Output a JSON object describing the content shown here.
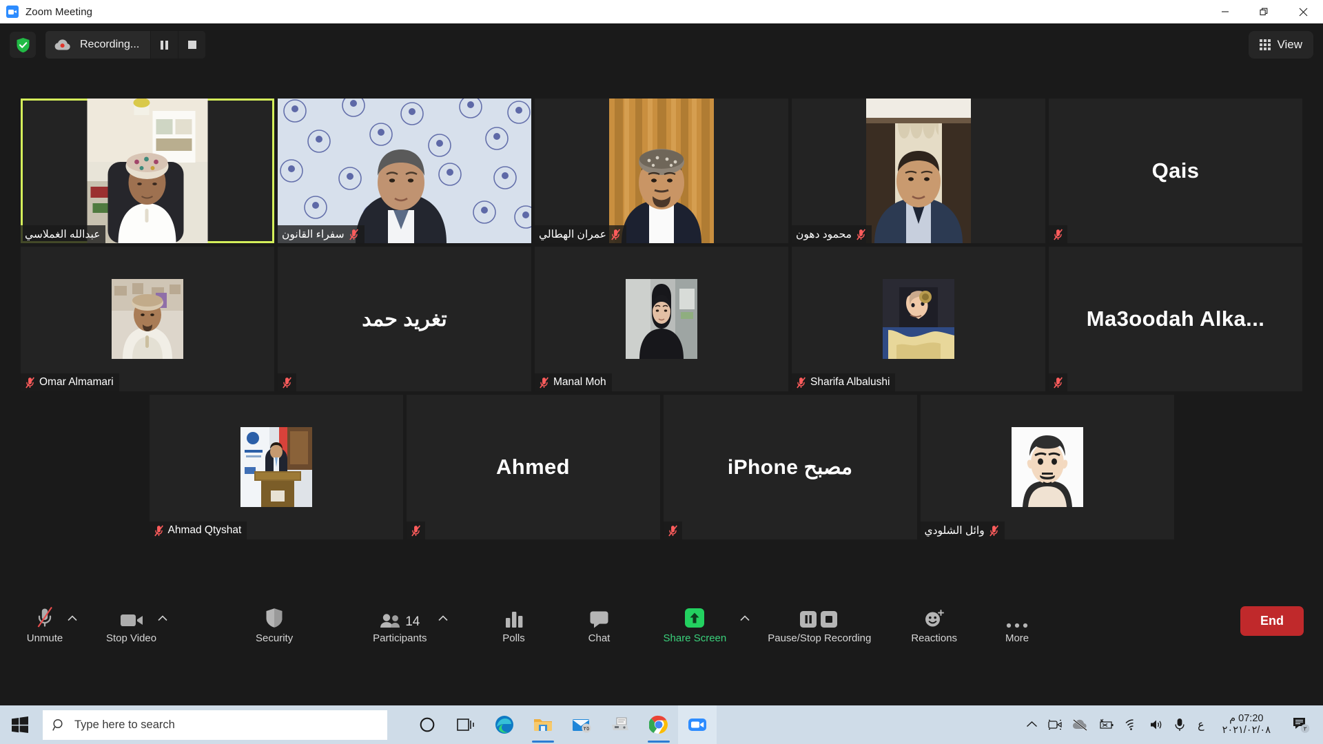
{
  "window": {
    "title": "Zoom Meeting",
    "app_icon": "zoom-icon",
    "minimize_label": "Minimize",
    "restore_label": "Restore",
    "close_label": "Close"
  },
  "header": {
    "security_shield": "shield-check-icon",
    "recording_label": "Recording...",
    "recording_icon": "recording-cloud-icon",
    "pause_recording_label": "Pause Recording",
    "stop_recording_label": "Stop Recording",
    "view_label": "View",
    "view_icon": "grid-view-icon"
  },
  "grid": {
    "rows": [
      [
        {
          "name": "عبدالله الغملاسي",
          "display": "name-strip",
          "video": true,
          "muted": false,
          "active_speaker": true,
          "rtl": true
        },
        {
          "name": "سفراء القانون",
          "display": "name-strip",
          "video": true,
          "muted": true,
          "active_speaker": false,
          "rtl": true
        },
        {
          "name": "عمران الهطالي",
          "display": "name-strip",
          "video": true,
          "muted": true,
          "active_speaker": false,
          "rtl": true
        },
        {
          "name": "محمود دهون",
          "display": "name-strip",
          "video": true,
          "muted": true,
          "active_speaker": false,
          "rtl": true
        },
        {
          "name": "Qais",
          "display": "big-name",
          "video": false,
          "muted": true,
          "active_speaker": false,
          "rtl": false
        }
      ],
      [
        {
          "name": "Omar Almamari",
          "display": "avatar",
          "video": false,
          "muted": true,
          "active_speaker": false,
          "rtl": false
        },
        {
          "name": "تغريد حمد",
          "display": "big-name",
          "video": false,
          "muted": true,
          "active_speaker": false,
          "rtl": true
        },
        {
          "name": "Manal Moh",
          "display": "avatar",
          "video": false,
          "muted": true,
          "active_speaker": false,
          "rtl": false
        },
        {
          "name": "Sharifa Albalushi",
          "display": "avatar",
          "video": false,
          "muted": true,
          "active_speaker": false,
          "rtl": false
        },
        {
          "name": "Ma3oodah Alka...",
          "display": "big-name",
          "video": false,
          "muted": true,
          "active_speaker": false,
          "rtl": false
        }
      ],
      [
        {
          "name": "Ahmad Qtyshat",
          "display": "avatar",
          "video": false,
          "muted": true,
          "active_speaker": false,
          "rtl": false
        },
        {
          "name": "Ahmed",
          "display": "big-name",
          "video": false,
          "muted": true,
          "active_speaker": false,
          "rtl": false
        },
        {
          "name": "مصبح iPhone",
          "display": "big-name",
          "video": false,
          "muted": true,
          "active_speaker": false,
          "rtl": true
        },
        {
          "name": "وائل الشلودي",
          "display": "avatar",
          "video": false,
          "muted": true,
          "active_speaker": false,
          "rtl": true
        }
      ]
    ]
  },
  "controls": {
    "unmute": {
      "label": "Unmute",
      "icon": "mic-muted-icon",
      "has_caret": true
    },
    "stop_video": {
      "label": "Stop Video",
      "icon": "video-camera-icon",
      "has_caret": true
    },
    "security": {
      "label": "Security",
      "icon": "shield-icon",
      "has_caret": false
    },
    "participants": {
      "label": "Participants",
      "icon": "people-icon",
      "count": "14",
      "has_caret": true
    },
    "polls": {
      "label": "Polls",
      "icon": "bar-chart-icon",
      "has_caret": false
    },
    "chat": {
      "label": "Chat",
      "icon": "speech-bubble-icon",
      "has_caret": false
    },
    "share_screen": {
      "label": "Share Screen",
      "icon": "share-arrow-up-icon",
      "has_caret": true
    },
    "recording": {
      "label": "Pause/Stop Recording",
      "icon": "pause-stop-icon",
      "has_caret": false
    },
    "reactions": {
      "label": "Reactions",
      "icon": "smiley-plus-icon",
      "has_caret": false
    },
    "more": {
      "label": "More",
      "icon": "ellipsis-icon",
      "has_caret": false
    },
    "end": {
      "label": "End"
    }
  },
  "taskbar": {
    "start_icon": "windows-start-icon",
    "search_placeholder": "Type here to search",
    "search_icon": "search-icon",
    "apps": [
      {
        "icon": "cortana-icon",
        "name": "cortana"
      },
      {
        "icon": "task-view-icon",
        "name": "task-view"
      },
      {
        "icon": "edge-icon",
        "name": "microsoft-edge"
      },
      {
        "icon": "file-explorer-icon",
        "name": "file-explorer"
      },
      {
        "icon": "mail-icon",
        "name": "mail",
        "badge": "٢٥"
      },
      {
        "icon": "fax-scan-icon",
        "name": "fax-and-scan"
      },
      {
        "icon": "chrome-icon",
        "name": "google-chrome"
      },
      {
        "icon": "zoom-icon",
        "name": "zoom"
      }
    ],
    "tray": [
      {
        "icon": "chevron-up-icon",
        "name": "show-hidden-icons"
      },
      {
        "icon": "camera-icon",
        "name": "camera-status"
      },
      {
        "icon": "onedrive-offline-icon",
        "name": "onedrive"
      },
      {
        "icon": "battery-error-icon",
        "name": "battery"
      },
      {
        "icon": "wifi-icon",
        "name": "network"
      },
      {
        "icon": "volume-icon",
        "name": "volume"
      },
      {
        "icon": "microphone-icon",
        "name": "microphone"
      }
    ],
    "language": "ع",
    "clock_time": "07:20 م",
    "clock_date": "٢٠٢١/٠٢/٠٨",
    "notifications_icon": "action-center-icon",
    "notifications_badge": "٢"
  },
  "colors": {
    "accent_green": "#0e9f42",
    "active_speaker_border": "#d4ef5a",
    "end_button": "#c0292b",
    "mute_red": "#ff5c5c",
    "taskbar": "#cfdce8"
  }
}
